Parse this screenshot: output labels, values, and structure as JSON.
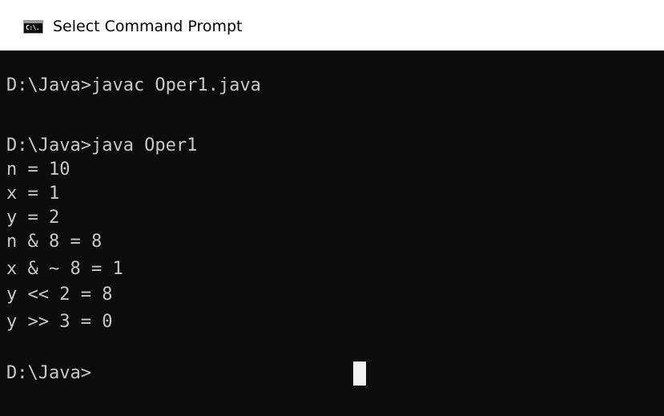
{
  "window": {
    "title": "Select Command Prompt",
    "icon": "cmd-icon",
    "icon_label": "C:\\."
  },
  "console": {
    "lines": [
      "D:\\Java>javac Oper1.java",
      "",
      "D:\\Java>java Oper1",
      "n = 10",
      "x = 1",
      "y = 2",
      "n & 8 = 8",
      "x & ~ 8 = 1",
      "y << 2 = 8",
      "y >> 3 = 0",
      "",
      "D:\\Java>"
    ],
    "colors": {
      "background": "#0c0c0c",
      "text": "#c8c8c8",
      "cursor": "#f2f2f2"
    }
  }
}
